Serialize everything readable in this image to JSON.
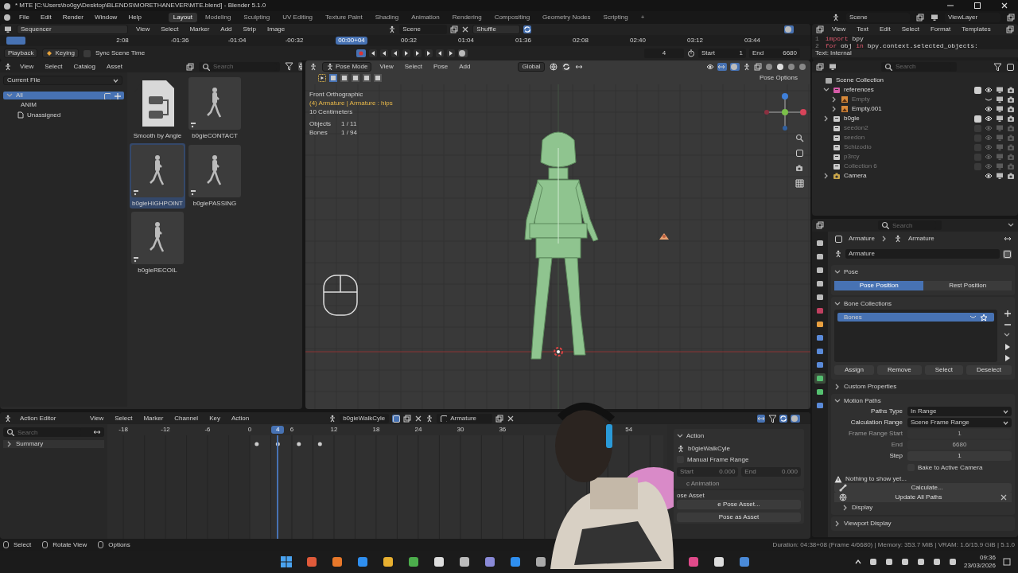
{
  "window": {
    "title": "* MTE [C:\\Users\\bo0gy\\Desktop\\BLENDS\\MORETHANEVER\\MTE.blend] - Blender 5.1.0"
  },
  "menu": [
    "File",
    "Edit",
    "Render",
    "Window",
    "Help"
  ],
  "workspaces": [
    {
      "label": "Layout",
      "selected": true
    },
    {
      "label": "Modeling",
      "selected": false
    },
    {
      "label": "Sculpting",
      "selected": false
    },
    {
      "label": "UV Editing",
      "selected": false
    },
    {
      "label": "Texture Paint",
      "selected": false
    },
    {
      "label": "Shading",
      "selected": false
    },
    {
      "label": "Animation",
      "selected": false
    },
    {
      "label": "Rendering",
      "selected": false
    },
    {
      "label": "Compositing",
      "selected": false
    },
    {
      "label": "Geometry Nodes",
      "selected": false
    },
    {
      "label": "Scripting",
      "selected": false
    }
  ],
  "add_workspace": "+",
  "scene": "Scene",
  "view_layer": "ViewLayer",
  "sequencer": {
    "editor": "Sequencer",
    "menus": [
      "View",
      "Select",
      "Marker",
      "Add",
      "Strip",
      "Image"
    ],
    "scene": "Scene",
    "sync_mode": "Shuffle",
    "ruler": [
      {
        "label": "2:08",
        "selected": false
      },
      {
        "label": "-01:36",
        "selected": false
      },
      {
        "label": "-01:04",
        "selected": false
      },
      {
        "label": "-00:32",
        "selected": false
      },
      {
        "label": "00:00+04",
        "selected": true
      },
      {
        "label": "00:32",
        "selected": false
      },
      {
        "label": "01:04",
        "selected": false
      },
      {
        "label": "01:36",
        "selected": false
      },
      {
        "label": "02:08",
        "selected": false
      },
      {
        "label": "02:40",
        "selected": false
      },
      {
        "label": "03:12",
        "selected": false
      },
      {
        "label": "03:44",
        "selected": false
      }
    ],
    "playback": "Playback",
    "keying": "Keying",
    "sync_label": "Sync Scene Time",
    "sync": false,
    "frame": "4",
    "start_label": "Start",
    "start": "1",
    "end_label": "End",
    "end": "6680"
  },
  "text_editor": {
    "menus": [
      "View",
      "Text",
      "Edit",
      "Select",
      "Format",
      "Templates"
    ],
    "lines": [
      {
        "number": "1",
        "tokens": [
          {
            "text": "import",
            "kind": "keyword"
          },
          {
            "text": " bpy",
            "kind": "plain"
          }
        ]
      },
      {
        "number": "2",
        "tokens": [
          {
            "text": "for",
            "kind": "keyword"
          },
          {
            "text": " obj ",
            "kind": "plain"
          },
          {
            "text": "in",
            "kind": "keyword"
          },
          {
            "text": " bpy.context.selected_objects:",
            "kind": "plain"
          }
        ]
      }
    ],
    "footer": "Text: Internal"
  },
  "asset_browser": {
    "menus": [
      "View",
      "Select",
      "Catalog",
      "Asset"
    ],
    "search": {
      "placeholder": "Search"
    },
    "library": "Current File",
    "catalogs": [
      {
        "label": "All",
        "selected": true,
        "expanded": true,
        "children": [
          {
            "label": "ANIM",
            "selected": false
          },
          {
            "label": "Unassigned",
            "selected": false
          }
        ]
      }
    ],
    "assets": [
      {
        "label": "Smooth by Angle",
        "kind": "node",
        "selected": false
      },
      {
        "label": "b0gieCONTACT",
        "kind": "pose",
        "selected": false
      },
      {
        "label": "b0gieHIGHPOINT",
        "kind": "pose",
        "selected": true
      },
      {
        "label": "b0giePASSING",
        "kind": "pose",
        "selected": false
      },
      {
        "label": "b0gieRECOIL",
        "kind": "pose",
        "selected": false
      }
    ]
  },
  "viewport": {
    "mode": "Pose Mode",
    "menus": [
      "View",
      "Select",
      "Pose",
      "Add"
    ],
    "orientation": "Global",
    "pose_options": "Pose Options",
    "view_name": "Front Orthographic",
    "active": "(4) Armature | Armature : hips",
    "scale": "10 Centimeters",
    "stats": [
      {
        "label": "Objects",
        "value": "1 / 11"
      },
      {
        "label": "Bones",
        "value": "1 / 94"
      }
    ]
  },
  "outliner": {
    "search": {
      "placeholder": "Search"
    },
    "tree": [
      {
        "label": "Scene Collection",
        "kind": "scene",
        "children": [
          {
            "label": "references",
            "kind": "collection",
            "color": "#d65ba8",
            "expanded": true,
            "checked": true,
            "visible": true,
            "children": [
              {
                "label": "Empty",
                "kind": "empty",
                "expanded": false,
                "visible": false
              },
              {
                "label": "Empty.001",
                "kind": "empty",
                "expanded": false,
                "visible": true
              }
            ]
          },
          {
            "label": "b0gle",
            "kind": "collection",
            "color": "#cccccc",
            "expanded": false,
            "checked": true,
            "visible": true
          },
          {
            "label": "seedon2",
            "kind": "collection",
            "color": "#cccccc",
            "checked": false,
            "visible": true
          },
          {
            "label": "seedon",
            "kind": "collection",
            "color": "#cccccc",
            "checked": false,
            "visible": true
          },
          {
            "label": "Schizodio",
            "kind": "collection",
            "color": "#cccccc",
            "checked": false,
            "visible": true
          },
          {
            "label": "p3rcy",
            "kind": "collection",
            "color": "#cccccc",
            "checked": false,
            "visible": true
          },
          {
            "label": "Collection 6",
            "kind": "collection",
            "color": "#cccccc",
            "checked": false,
            "visible": true
          },
          {
            "label": "Camera",
            "kind": "camera",
            "expanded": false,
            "visible": true
          }
        ]
      }
    ]
  },
  "properties": {
    "search": {
      "placeholder": "Search"
    },
    "tabs": [
      {
        "kind": "tool",
        "selected": false
      },
      {
        "kind": "render",
        "selected": false
      },
      {
        "kind": "output",
        "selected": false
      },
      {
        "kind": "view_layer",
        "selected": false
      },
      {
        "kind": "scene",
        "selected": false
      },
      {
        "kind": "world",
        "selected": false
      },
      {
        "kind": "object",
        "selected": false
      },
      {
        "kind": "modifier",
        "selected": false
      },
      {
        "kind": "physics",
        "selected": false
      },
      {
        "kind": "pose",
        "selected": false
      },
      {
        "kind": "data",
        "selected": true
      },
      {
        "kind": "bone",
        "selected": false
      },
      {
        "kind": "constraint",
        "selected": false
      }
    ],
    "breadcrumb": [
      "Armature",
      "Armature"
    ],
    "data_name": "Armature",
    "pose": {
      "title": "Pose",
      "expanded": true,
      "options": [
        {
          "label": "Pose Position",
          "selected": true
        },
        {
          "label": "Rest Position",
          "selected": false
        }
      ]
    },
    "bone_collections": {
      "title": "Bone Collections",
      "expanded": true,
      "items": [
        {
          "label": "Bones",
          "selected": true
        }
      ],
      "buttons": [
        "Assign",
        "Remove",
        "Select",
        "Deselect"
      ]
    },
    "custom_properties": {
      "title": "Custom Properties",
      "expanded": false
    },
    "motion_paths": {
      "title": "Motion Paths",
      "expanded": true,
      "fields": [
        {
          "label": "Paths Type",
          "value": "In Range",
          "kind": "dropdown",
          "disabled": false
        },
        {
          "label": "Calculation Range",
          "value": "Scene Frame Range",
          "kind": "dropdown",
          "disabled": false
        },
        {
          "label": "Frame Range Start",
          "value": "1",
          "kind": "number",
          "disabled": true
        },
        {
          "label": "End",
          "value": "6680",
          "kind": "number",
          "disabled": true
        },
        {
          "label": "Step",
          "value": "1",
          "kind": "number",
          "disabled": false
        }
      ],
      "bake": {
        "label": "Bake to Active Camera",
        "checked": false
      },
      "warning": "Nothing to show yet...",
      "calculate": "Calculate...",
      "update": "Update All Paths"
    },
    "display": {
      "title": "Display",
      "expanded": false
    },
    "viewport_display": {
      "title": "Viewport Display",
      "expanded": false
    }
  },
  "action_editor": {
    "editor": "Action Editor",
    "menus": [
      "View",
      "Select",
      "Marker",
      "Channel",
      "Key",
      "Action"
    ],
    "action": "b0gieWalkCyle",
    "slot": "Armature",
    "search": {
      "placeholder": "Search"
    },
    "channels": [
      "Summary"
    ],
    "ruler": [
      {
        "label": "-18",
        "selected": false
      },
      {
        "label": "-12",
        "selected": false
      },
      {
        "label": "-6",
        "selected": false
      },
      {
        "label": "0",
        "selected": false
      },
      {
        "label": "4",
        "selected": true
      },
      {
        "label": "6",
        "selected": false
      },
      {
        "label": "12",
        "selected": false
      },
      {
        "label": "18",
        "selected": false
      },
      {
        "label": "24",
        "selected": false
      },
      {
        "label": "30",
        "selected": false
      },
      {
        "label": "36",
        "selected": false
      },
      {
        "label": "54",
        "selected": false
      }
    ],
    "sidebar": {
      "panel": "Action",
      "action": "b0gieWalkCyle",
      "manual_range": {
        "label": "Manual Frame Range",
        "checked": false
      },
      "start_label": "Start",
      "start": "0.000",
      "end_label": "End",
      "end": "0.000",
      "cyclic": "c Animation",
      "pose_asset": "ose Asset",
      "create": "e Pose Asset...",
      "copy": "Pose as Asset"
    }
  },
  "status_bar": {
    "hints": [
      "Select",
      "Rotate View",
      "Options"
    ],
    "info": "Duration: 04:38+08 (Frame 4/6680) | Memory: 353.7 MiB | VRAM: 1.6/15.9 GiB | 5.1.0"
  },
  "taskbar": {
    "time": "09:36",
    "date": "23/03/2026"
  },
  "webcam": {
    "kind": "picture"
  }
}
